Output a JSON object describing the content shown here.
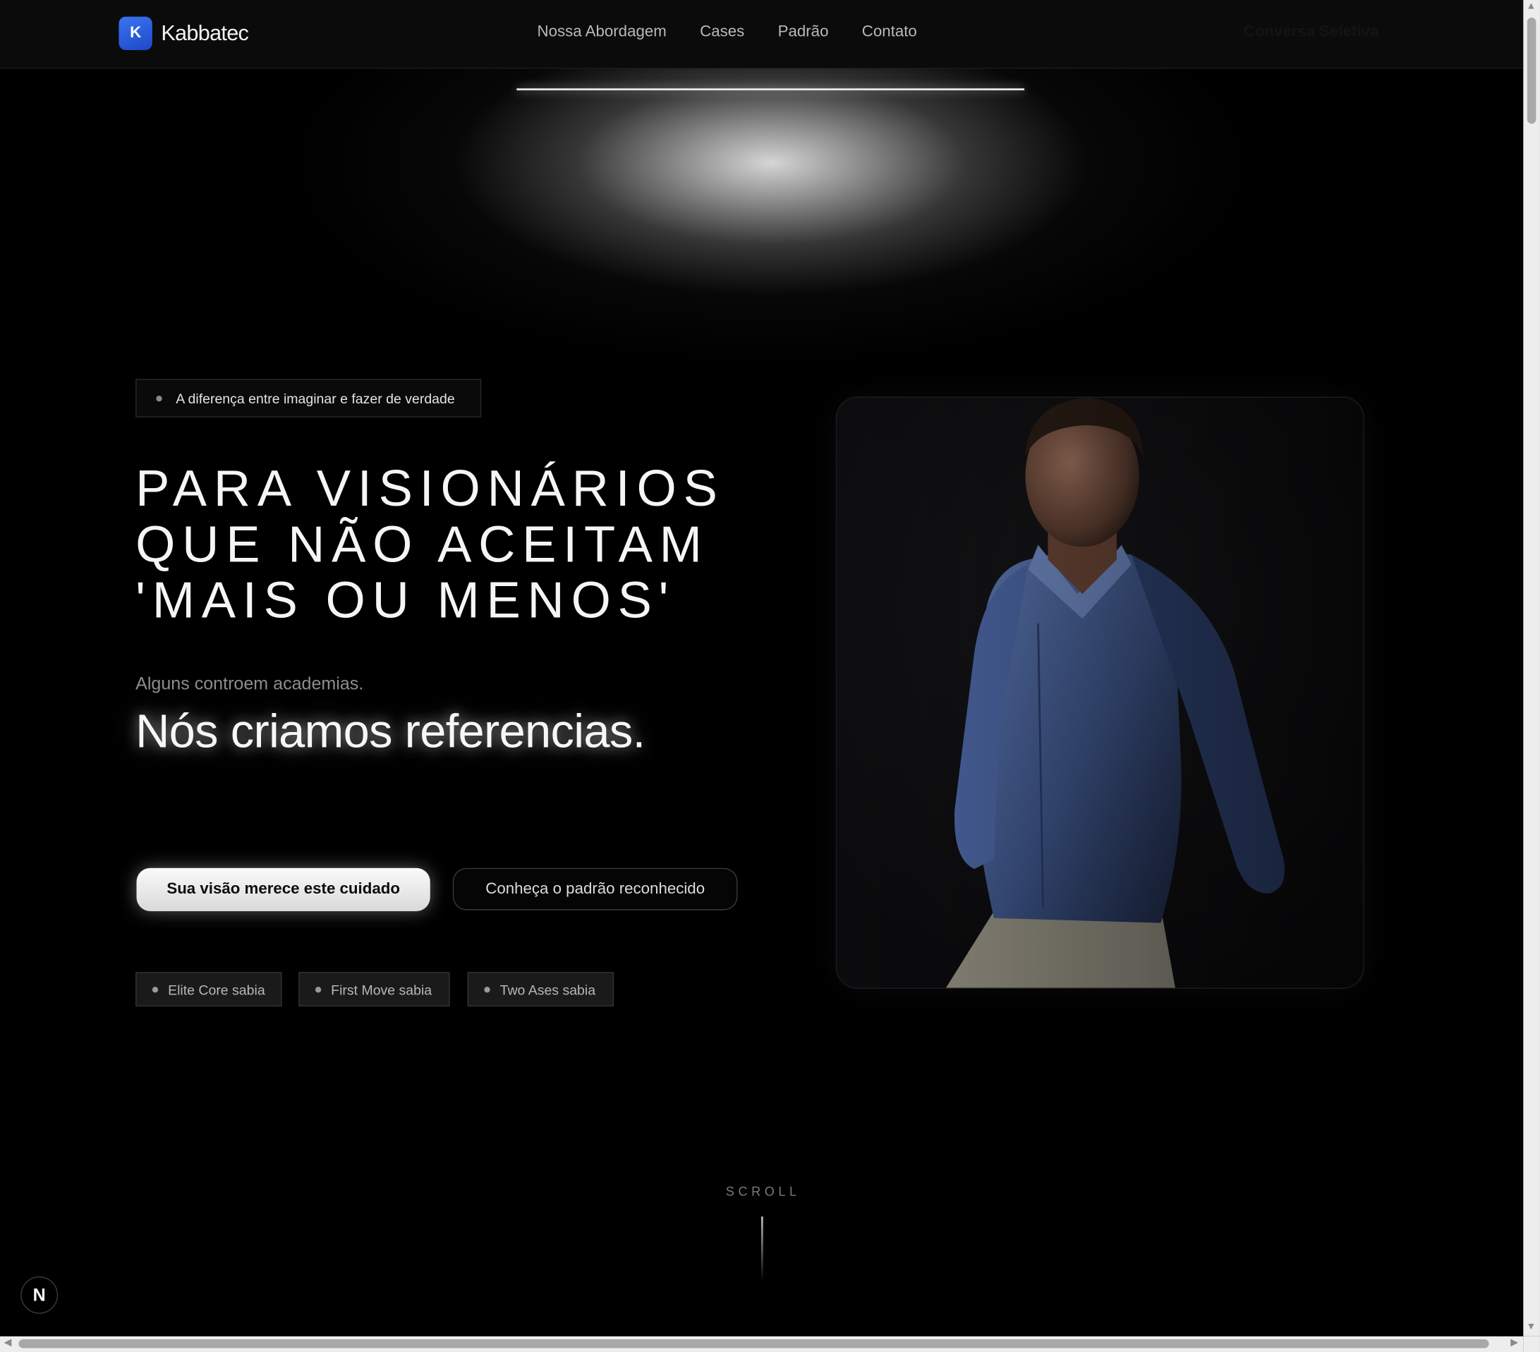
{
  "header": {
    "logo_letter": "K",
    "brand": "Kabbatec",
    "nav": [
      "Nossa Abordagem",
      "Cases",
      "Padrão",
      "Contato"
    ],
    "cta": "Conversa Seletiva"
  },
  "hero": {
    "tag": "A diferença entre imaginar e fazer de verdade",
    "headline_lines": [
      "PARA VISIONÁRIOS",
      "QUE NÃO ACEITAM",
      "'MAIS OU MENOS'"
    ],
    "sub_small": "Alguns controem academias.",
    "sub_big": "Nós criamos referencias.",
    "primary_button": "Sua visão merece este cuidado",
    "secondary_button": "Conheça o padrão reconhecido",
    "chips": [
      "Elite Core sabia",
      "First Move sabia",
      "Two Ases sabia"
    ]
  },
  "scroll": {
    "label": "SCROLL"
  },
  "badge": {
    "letter": "N"
  },
  "colors": {
    "accent": "#2f62e0",
    "background": "#000000"
  }
}
